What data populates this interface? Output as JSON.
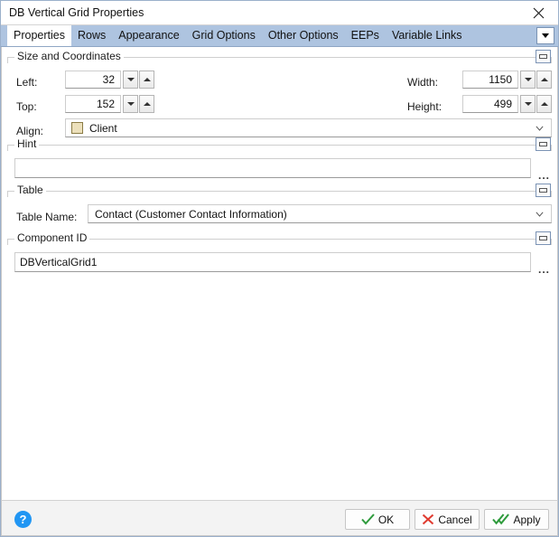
{
  "window": {
    "title": "DB Vertical Grid Properties",
    "close_icon": "close-icon"
  },
  "tabs": {
    "items": [
      {
        "label": "Properties",
        "active": true
      },
      {
        "label": "Rows",
        "active": false
      },
      {
        "label": "Appearance",
        "active": false
      },
      {
        "label": "Grid Options",
        "active": false
      },
      {
        "label": "Other Options",
        "active": false
      },
      {
        "label": "EEPs",
        "active": false
      },
      {
        "label": "Variable Links",
        "active": false
      }
    ],
    "overflow_icon": "chevron-down-icon"
  },
  "size_and_coordinates": {
    "caption": "Size and Coordinates",
    "left_label": "Left:",
    "left_value": "32",
    "top_label": "Top:",
    "top_value": "152",
    "width_label": "Width:",
    "width_value": "1150",
    "height_label": "Height:",
    "height_value": "499",
    "align_label": "Align:",
    "align_value": "Client",
    "align_swatch_color": "#ece0bb"
  },
  "hint": {
    "caption": "Hint",
    "value": "",
    "placeholder": "",
    "ellipsis_label": "..."
  },
  "table": {
    "caption": "Table",
    "name_label": "Table Name:",
    "name_value": "Contact  (Customer Contact Information)"
  },
  "component_id": {
    "caption": "Component ID",
    "value": "DBVerticalGrid1",
    "ellipsis_label": "..."
  },
  "footer": {
    "help_label": "?",
    "ok_label": "OK",
    "cancel_label": "Cancel",
    "apply_label": "Apply",
    "ok_color": "#2e9b3c",
    "cancel_color": "#e03a2f",
    "apply_color": "#2e9b3c"
  }
}
